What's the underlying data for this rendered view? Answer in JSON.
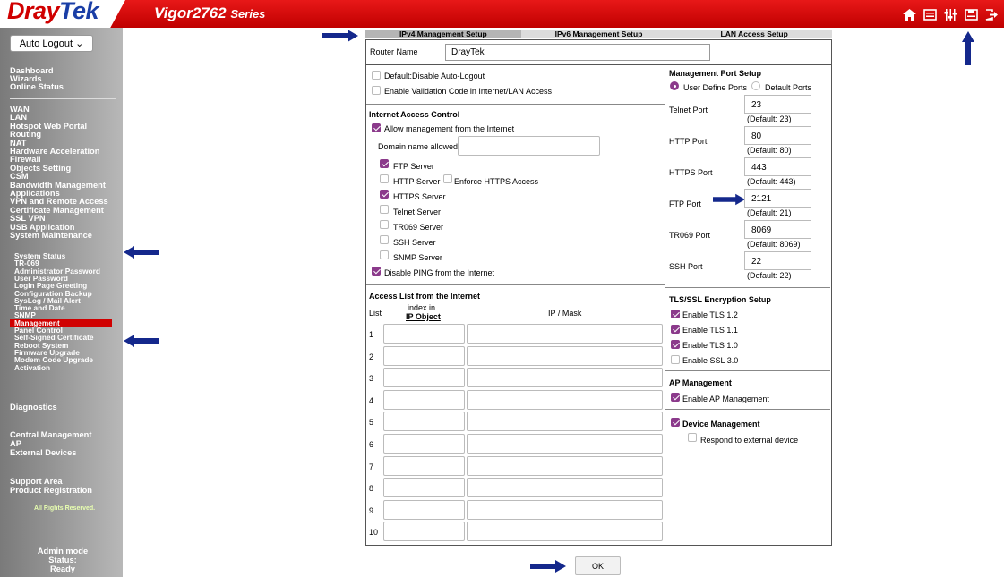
{
  "header": {
    "logo_dray": "Dray",
    "logo_tek": "Tek",
    "model_name": "Vigor2762",
    "model_series": "Series",
    "icons": [
      "home-icon",
      "quick-start-icon",
      "settings-icon",
      "save-icon",
      "logout-icon"
    ]
  },
  "sidebar": {
    "logout_select": "Auto Logout",
    "group1": [
      "Dashboard",
      "Wizards",
      "Online Status"
    ],
    "group2": [
      "WAN",
      "LAN",
      "Hotspot Web Portal",
      "Routing",
      "NAT",
      "Hardware Acceleration",
      "Firewall",
      "Objects Setting",
      "CSM",
      "Bandwidth Management",
      "Applications",
      "VPN and Remote Access",
      "Certificate Management",
      "SSL VPN",
      "USB Application",
      "System Maintenance"
    ],
    "submenu": [
      "System Status",
      "TR-069",
      "Administrator Password",
      "User Password",
      "Login Page Greeting",
      "Configuration Backup",
      "SysLog / Mail Alert",
      "Time and Date",
      "SNMP",
      "Management",
      "Panel Control",
      "Self-Signed Certificate",
      "Reboot System",
      "Firmware Upgrade",
      "Modem Code Upgrade",
      "Activation"
    ],
    "diagnostics": "Diagnostics",
    "group3": [
      "Central Management",
      "AP",
      "External Devices"
    ],
    "group4": [
      "Support Area",
      "Product Registration"
    ],
    "rights": "All Rights Reserved.",
    "mode": "Admin mode",
    "status": "Status: Ready"
  },
  "tabs": [
    "IPv4 Management Setup",
    "IPv6 Management Setup",
    "LAN Access Setup"
  ],
  "router_name": {
    "label": "Router Name",
    "value": "DrayTek"
  },
  "left": {
    "default_logout": "Default:Disable Auto-Logout",
    "validation_code": "Enable Validation Code in Internet/LAN Access",
    "iac_title": "Internet Access Control",
    "allow_mgmt": "Allow management from the Internet",
    "domain_label": "Domain name allowed",
    "ftp_server": "FTP Server",
    "http_server": "HTTP Server",
    "enforce_https": "Enforce HTTPS Access",
    "https_server": "HTTPS Server",
    "telnet_server": "Telnet Server",
    "tr069_server": "TR069 Server",
    "ssh_server": "SSH Server",
    "snmp_server": "SNMP Server",
    "disable_ping": "Disable PING from the Internet",
    "access_list_title": "Access List from the Internet",
    "col_list": "List",
    "col_index": "index in",
    "col_ipobject": "IP Object",
    "col_ipmask": "IP / Mask",
    "rows": [
      "1",
      "2",
      "3",
      "4",
      "5",
      "6",
      "7",
      "8",
      "9",
      "10"
    ]
  },
  "right": {
    "mps_title": "Management Port Setup",
    "user_define": "User Define Ports",
    "default_ports": "Default Ports",
    "ports": [
      {
        "label": "Telnet Port",
        "value": "23",
        "default": "(Default: 23)"
      },
      {
        "label": "HTTP Port",
        "value": "80",
        "default": "(Default: 80)"
      },
      {
        "label": "HTTPS Port",
        "value": "443",
        "default": "(Default: 443)"
      },
      {
        "label": "FTP Port",
        "value": "2121",
        "default": "(Default: 21)"
      },
      {
        "label": "TR069 Port",
        "value": "8069",
        "default": "(Default: 8069)"
      },
      {
        "label": "SSH Port",
        "value": "22",
        "default": "(Default: 22)"
      }
    ],
    "tls_title": "TLS/SSL Encryption Setup",
    "tls12": "Enable TLS 1.2",
    "tls11": "Enable TLS 1.1",
    "tls10": "Enable TLS 1.0",
    "ssl30": "Enable SSL 3.0",
    "ap_title": "AP Management",
    "ap_enable": "Enable AP Management",
    "device_mgmt": "Device Management",
    "respond": "Respond to external device"
  },
  "ok_label": "OK",
  "colors": {
    "header_red": "#d00000",
    "check_purple": "#8b3a8b",
    "arrow_navy": "#14288c"
  }
}
